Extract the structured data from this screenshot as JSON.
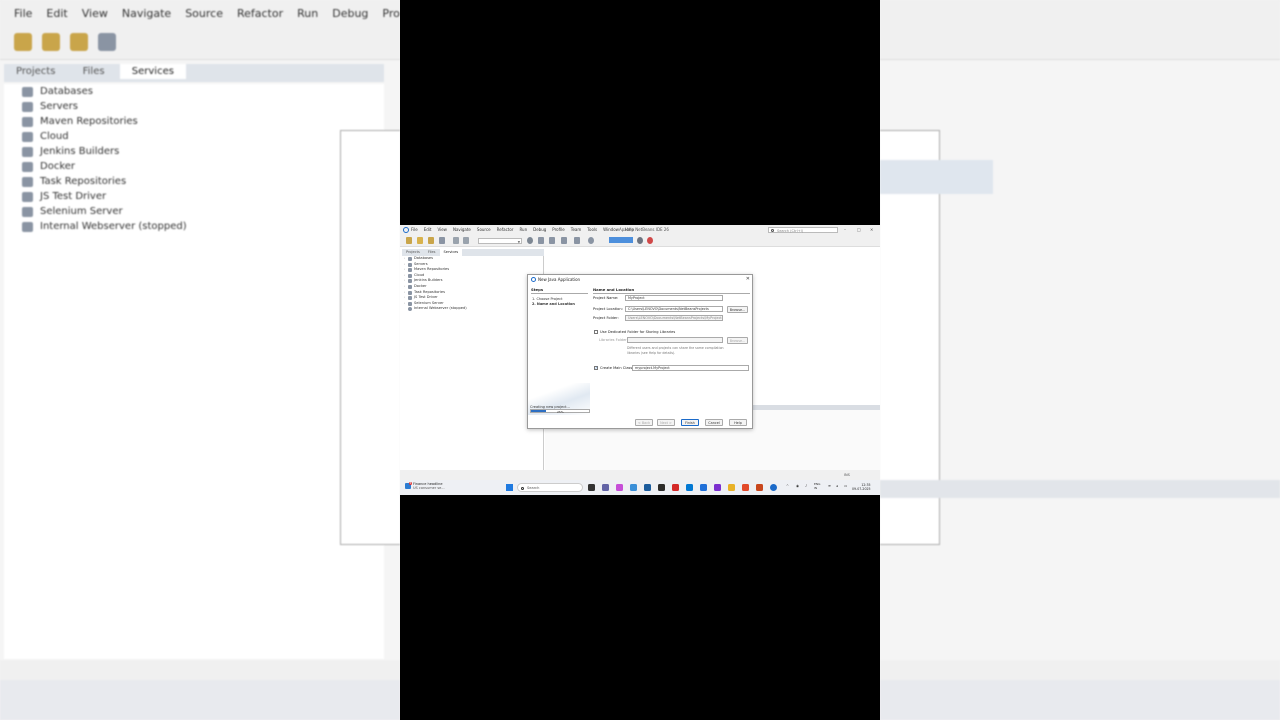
{
  "app": {
    "title": "Apache NetBeans IDE 26",
    "menu": [
      "File",
      "Edit",
      "View",
      "Navigate",
      "Source",
      "Refactor",
      "Run",
      "Debug",
      "Profile",
      "Team",
      "Tools",
      "Window",
      "Help"
    ],
    "search_placeholder": "Search (Ctrl+I)",
    "window_controls": [
      "–",
      "□",
      "✕"
    ]
  },
  "panel_tabs": [
    "Projects",
    "Files",
    "Services"
  ],
  "services": [
    "Databases",
    "Servers",
    "Maven Repositories",
    "Cloud",
    "Jenkins Builders",
    "Docker",
    "Task Repositories",
    "JS Test Driver",
    "Selenium Server",
    "Internal Webserver (stopped)"
  ],
  "dialog": {
    "title": "New Java Application",
    "close": "✕",
    "steps_heading": "Steps",
    "steps": [
      {
        "num": "1.",
        "label": "Choose Project"
      },
      {
        "num": "2.",
        "label": "Name and Location"
      }
    ],
    "panel_heading": "Name and Location",
    "project_name_label": "Project Name:",
    "project_name": "MyProject",
    "project_location_label": "Project Location:",
    "project_location": "C:\\Users\\LENOVO\\Documents\\NetBeansProjects",
    "project_folder_label": "Project Folder:",
    "project_folder": "Users\\LENOVO\\Documents\\NetBeansProjects\\MyProject",
    "browse": "Browse...",
    "dedicated_label": "Use Dedicated Folder for Storing Libraries",
    "libraries_label": "Libraries Folder:",
    "note": "Different users and projects can share the same compilation libraries (see Help for details).",
    "main_class_label": "Create Main Class",
    "main_class": "myproject.MyProject",
    "progress_label": "Creating new project...",
    "progress_value": 0.25,
    "progress_pct": "25%",
    "buttons": {
      "back": "< Back",
      "next": "Next >",
      "finish": "Finish",
      "cancel": "Cancel",
      "help": "Help"
    }
  },
  "status": {
    "mode": "INS"
  },
  "taskbar": {
    "news_title": "Finance headline",
    "news_sub": "US consumer se...",
    "news_badge": "4",
    "search": "Search",
    "lang1": "ENG",
    "lang2": "IN",
    "time": "12:35",
    "date": "09-07-2025"
  },
  "colors": {
    "accent": "#1b6ac9",
    "progress": "#2d6fc3",
    "toolbar_icon": "#c9a54a"
  }
}
